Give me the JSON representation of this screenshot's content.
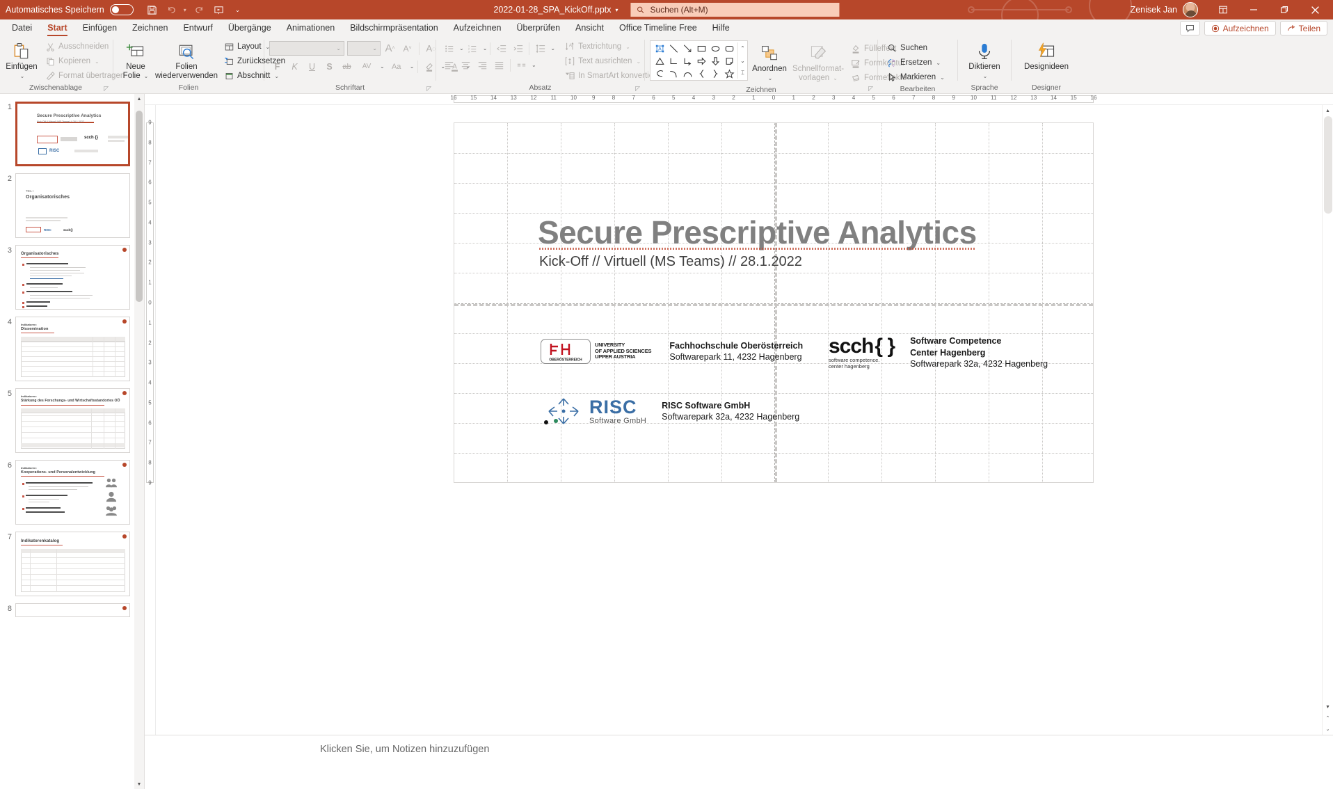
{
  "titlebar": {
    "autosave_label": "Automatisches Speichern",
    "autosave_state": "off",
    "save_icon": "save-icon",
    "undo_icon": "undo-icon",
    "redo_icon": "redo-icon",
    "present_icon": "start-presentation-icon",
    "customize_icon": "customize-quick-access-icon",
    "document_title": "2022-01-28_SPA_KickOff.pptx",
    "search_icon": "search-icon",
    "search_placeholder": "Suchen (Alt+M)",
    "user_name": "Zenisek Jan",
    "avatar": "user-avatar",
    "ribbon_display_icon": "ribbon-display-options-icon",
    "minimize": "minimize-icon",
    "restore": "restore-icon",
    "close": "close-icon",
    "accent_color": "#b7472a",
    "search_bg": "#f9cdb9"
  },
  "tabs": [
    {
      "label": "Datei",
      "active": false
    },
    {
      "label": "Start",
      "active": true
    },
    {
      "label": "Einfügen",
      "active": false
    },
    {
      "label": "Zeichnen",
      "active": false
    },
    {
      "label": "Entwurf",
      "active": false
    },
    {
      "label": "Übergänge",
      "active": false
    },
    {
      "label": "Animationen",
      "active": false
    },
    {
      "label": "Bildschirmpräsentation",
      "active": false
    },
    {
      "label": "Aufzeichnen",
      "active": false
    },
    {
      "label": "Überprüfen",
      "active": false
    },
    {
      "label": "Ansicht",
      "active": false
    },
    {
      "label": "Office Timeline Free",
      "active": false
    },
    {
      "label": "Hilfe",
      "active": false
    }
  ],
  "tabs_right": {
    "comments_icon": "comment-icon",
    "record_label": "Aufzeichnen",
    "record_icon": "record-circle-icon",
    "share_label": "Teilen",
    "share_icon": "share-icon"
  },
  "ribbon": {
    "groups": [
      {
        "name": "Zwischenablage",
        "label": "Zwischenablage",
        "has_launcher": true,
        "big": {
          "label1": "Einfügen",
          "label2": "",
          "icon": "paste-icon",
          "disabled": false,
          "has_chevron": true
        },
        "items": [
          {
            "label": "Ausschneiden",
            "icon": "cut-icon",
            "disabled": true,
            "chevron": false
          },
          {
            "label": "Kopieren",
            "icon": "copy-icon",
            "disabled": true,
            "chevron": true
          },
          {
            "label": "Format übertragen",
            "icon": "format-painter-icon",
            "disabled": true,
            "chevron": false
          }
        ]
      },
      {
        "name": "Folien",
        "label": "Folien",
        "has_launcher": false,
        "big1": {
          "label1": "Neue",
          "label2": "Folie",
          "icon": "new-slide-icon",
          "has_chevron": true
        },
        "big2": {
          "label1": "Folien",
          "label2": "wiederverwenden",
          "icon": "reuse-slides-icon",
          "has_chevron": false
        },
        "items": [
          {
            "label": "Layout",
            "icon": "layout-icon",
            "disabled": false,
            "chevron": true
          },
          {
            "label": "Zurücksetzen",
            "icon": "reset-icon",
            "disabled": false,
            "chevron": false
          },
          {
            "label": "Abschnitt",
            "icon": "section-icon",
            "disabled": false,
            "chevron": true
          }
        ]
      },
      {
        "name": "Schriftart",
        "label": "Schriftart",
        "has_launcher": true,
        "font_name": "",
        "font_size": "",
        "row1": [
          {
            "icon": "increase-font-size-icon",
            "glyph": "A",
            "disabled": true
          },
          {
            "icon": "decrease-font-size-icon",
            "glyph": "A",
            "disabled": true
          },
          {
            "icon": "clear-formatting-icon",
            "glyph": "A",
            "disabled": true
          }
        ],
        "row2": [
          {
            "icon": "bold-icon",
            "glyph": "F",
            "disabled": true
          },
          {
            "icon": "italic-icon",
            "glyph": "K",
            "disabled": true
          },
          {
            "icon": "underline-icon",
            "glyph": "U",
            "disabled": true
          },
          {
            "icon": "shadow-icon",
            "glyph": "S",
            "disabled": true
          },
          {
            "icon": "strikethrough-icon",
            "glyph": "ab",
            "disabled": true
          },
          {
            "icon": "character-spacing-icon",
            "glyph": "AV",
            "disabled": true
          },
          {
            "icon": "change-case-icon",
            "glyph": "Aa",
            "disabled": true
          },
          {
            "icon": "text-highlight-color-icon",
            "glyph": "",
            "disabled": true
          },
          {
            "icon": "font-color-icon",
            "glyph": "A",
            "disabled": true
          }
        ]
      },
      {
        "name": "Absatz",
        "label": "Absatz",
        "has_launcher": true,
        "row1": [
          {
            "icon": "bullet-list-icon",
            "disabled": true,
            "chevron": true
          },
          {
            "icon": "numbered-list-icon",
            "disabled": true,
            "chevron": true
          },
          {
            "icon": "decrease-indent-icon",
            "disabled": true,
            "chevron": false
          },
          {
            "icon": "increase-indent-icon",
            "disabled": true,
            "chevron": false
          },
          {
            "icon": "line-spacing-icon",
            "disabled": true,
            "chevron": true
          }
        ],
        "row2": [
          {
            "icon": "align-left-icon",
            "disabled": true
          },
          {
            "icon": "align-center-icon",
            "disabled": true
          },
          {
            "icon": "align-right-icon",
            "disabled": true
          },
          {
            "icon": "justify-icon",
            "disabled": true
          },
          {
            "icon": "columns-icon",
            "disabled": true,
            "chevron": true
          }
        ],
        "items": [
          {
            "label": "Textrichtung",
            "icon": "text-direction-icon",
            "disabled": true,
            "chevron": true
          },
          {
            "label": "Text ausrichten",
            "icon": "align-text-icon",
            "disabled": true,
            "chevron": true
          },
          {
            "label": "In SmartArt konvertieren",
            "icon": "convert-to-smartart-icon",
            "disabled": true,
            "chevron": true
          }
        ]
      },
      {
        "name": "Zeichnen",
        "label": "Zeichnen",
        "has_launcher": true,
        "shapes": [
          "textbox-shape-icon",
          "line-shape-icon",
          "arrow-shape-icon",
          "rectangle-shape-icon",
          "oval-shape-icon",
          "rounded-rectangle-shape-icon",
          "triangle-shape-icon",
          "elbow-connector-shape-icon",
          "elbow-arrow-connector-shape-icon",
          "block-arrow-shape-icon",
          "down-arrow-shape-icon",
          "folded-corner-shape-icon",
          "scribble-shape-icon",
          "curve-shape-icon",
          "arc-shape-icon",
          "left-brace-shape-icon",
          "right-brace-shape-icon",
          "star-shape-icon"
        ],
        "scroll_up_icon": "scroll-up-icon",
        "scroll_down_icon": "scroll-down-icon",
        "more_shapes_icon": "more-shapes-icon",
        "big1": {
          "label1": "Anordnen",
          "label2": "",
          "icon": "arrange-icon",
          "has_chevron": true,
          "disabled": false
        },
        "big2": {
          "label1": "Schnellformat-",
          "label2": "vorlagen",
          "icon": "quick-styles-icon",
          "has_chevron": true,
          "disabled": true
        },
        "items": [
          {
            "label": "Fülleffekt",
            "icon": "shape-fill-icon",
            "disabled": true,
            "chevron": true
          },
          {
            "label": "Formkontur",
            "icon": "shape-outline-icon",
            "disabled": true,
            "chevron": true
          },
          {
            "label": "Formeffekte",
            "icon": "shape-effects-icon",
            "disabled": true,
            "chevron": true
          }
        ]
      },
      {
        "name": "Bearbeiten",
        "label": "Bearbeiten",
        "has_launcher": false,
        "items": [
          {
            "label": "Suchen",
            "icon": "find-icon",
            "disabled": false,
            "chevron": false
          },
          {
            "label": "Ersetzen",
            "icon": "replace-icon",
            "disabled": false,
            "chevron": true
          },
          {
            "label": "Markieren",
            "icon": "select-icon",
            "disabled": false,
            "chevron": true
          }
        ]
      },
      {
        "name": "Sprache",
        "label": "Sprache",
        "has_launcher": false,
        "big": {
          "label1": "Diktieren",
          "label2": "",
          "icon": "dictate-microphone-icon",
          "has_chevron": true,
          "disabled": false
        }
      },
      {
        "name": "Designer",
        "label": "Designer",
        "has_launcher": false,
        "big": {
          "label1": "Designideen",
          "label2": "",
          "icon": "design-ideas-icon",
          "has_chevron": false,
          "disabled": false
        }
      }
    ]
  },
  "thumbnails": {
    "scroll_up_icon": "scroll-up-icon",
    "scroll_down_icon": "scroll-down-icon",
    "slides": [
      {
        "number": "1",
        "selected": true,
        "title": "Secure Prescriptive Analytics",
        "subtitle": "Kick-Off  //  Virtuell (MS Teams)  //  28.1.2022",
        "kind": "title"
      },
      {
        "number": "2",
        "selected": false,
        "title": "Organisatorisches",
        "eyebrow": "TEIL I",
        "kind": "section"
      },
      {
        "number": "3",
        "selected": false,
        "title": "Organisatorisches",
        "kind": "bullets"
      },
      {
        "number": "4",
        "selected": false,
        "title": "Dissemination",
        "eyebrow": "Indikatoren:",
        "kind": "table"
      },
      {
        "number": "5",
        "selected": false,
        "title": "Stärkung des Forschungs- und Wirtschaftsstandortes OÖ",
        "eyebrow": "Indikatoren:",
        "kind": "table"
      },
      {
        "number": "6",
        "selected": false,
        "title": "Kooperations- und Personalentwicklung",
        "eyebrow": "Indikatoren:",
        "kind": "bullets-icons"
      },
      {
        "number": "7",
        "selected": false,
        "title": "Indikatorenkatalog",
        "kind": "table"
      },
      {
        "number": "8",
        "selected": false,
        "title": "",
        "kind": "partial"
      }
    ]
  },
  "ruler": {
    "horizontal_ticks": [
      "16",
      "15",
      "14",
      "13",
      "12",
      "11",
      "10",
      "9",
      "8",
      "7",
      "6",
      "5",
      "4",
      "3",
      "2",
      "1",
      "0",
      "1",
      "2",
      "3",
      "4",
      "5",
      "6",
      "7",
      "8",
      "9",
      "10",
      "11",
      "12",
      "13",
      "14",
      "15",
      "16"
    ],
    "vertical_ticks": [
      "9",
      "8",
      "7",
      "6",
      "5",
      "4",
      "3",
      "2",
      "1",
      "0",
      "1",
      "2",
      "3",
      "4",
      "5",
      "6",
      "7",
      "8",
      "9"
    ]
  },
  "slide": {
    "title": "Secure Prescriptive Analytics",
    "subtitle": "Kick-Off  //  Virtuell (MS Teams)  //  28.1.2022",
    "partners": [
      {
        "logo": "fh-oberoesterreich-logo",
        "logo_text_1": "UNIVERSITY",
        "logo_text_2": "OF APPLIED SCIENCES",
        "logo_text_3": "UPPER AUSTRIA",
        "logo_badge": "OBERÖSTERREICH",
        "name": "Fachhochschule Oberösterreich",
        "address": "Softwarepark 11, 4232 Hagenberg"
      },
      {
        "logo": "scch-logo",
        "logo_text_1": "scch",
        "logo_text_2": "{ }",
        "logo_sub_1": "software competence.",
        "logo_sub_2": "center hagenberg",
        "name": "Software Competence",
        "name2": "Center Hagenberg",
        "address": "Softwarepark 32a, 4232 Hagenberg"
      },
      {
        "logo": "risc-software-logo",
        "logo_text_1": "RISC",
        "logo_text_2": "Software GmbH",
        "name": "RISC Software GmbH",
        "address": "Softwarepark 32a, 4232 Hagenberg"
      }
    ]
  },
  "notes": {
    "placeholder": "Klicken Sie, um Notizen hinzuzufügen"
  }
}
